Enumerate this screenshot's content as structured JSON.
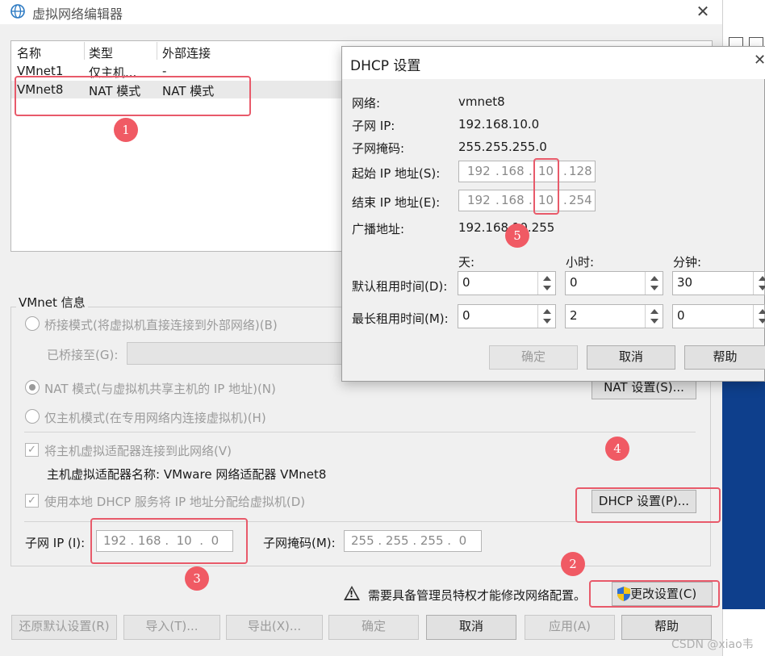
{
  "window": {
    "title": "虚拟网络编辑器",
    "close_glyph": "✕"
  },
  "network_list": {
    "columns": [
      "名称",
      "类型",
      "外部连接"
    ],
    "rows": [
      {
        "name": "VMnet1",
        "type": "仅主机...",
        "external": "-"
      },
      {
        "name": "VMnet8",
        "type": "NAT 模式",
        "external": "NAT 模式"
      }
    ]
  },
  "vmnet_info": {
    "group_label": "VMnet 信息",
    "bridge_mode": "桥接模式(将虚拟机直接连接到外部网络)(B)",
    "bridged_to_label": "已桥接至(G):",
    "nat_mode": "NAT 模式(与虚拟机共享主机的 IP 地址)(N)",
    "nat_settings_button": "NAT 设置(S)...",
    "host_only_mode": "仅主机模式(在专用网络内连接虚拟机)(H)",
    "connect_adapter": "将主机虚拟适配器连接到此网络(V)",
    "adapter_name": "主机虚拟适配器名称: VMware 网络适配器 VMnet8",
    "use_dhcp": "使用本地 DHCP 服务将 IP 地址分配给虚拟机(D)",
    "dhcp_settings_button": "DHCP 设置(P)...",
    "subnet_ip_label": "子网 IP (I):",
    "subnet_ip_value": "192 . 168 .  10  .  0",
    "subnet_mask_label": "子网掩码(M):",
    "subnet_mask_value": "255 . 255 . 255 .  0"
  },
  "admin_notice": "需要具备管理员特权才能修改网络配置。",
  "change_settings_button": "更改设置(C)",
  "bottom_buttons": {
    "restore": "还原默认设置(R)",
    "import": "导入(T)...",
    "export": "导出(X)...",
    "ok": "确定",
    "cancel": "取消",
    "apply": "应用(A)",
    "help": "帮助"
  },
  "dhcp_dialog": {
    "title": "DHCP 设置",
    "close_glyph": "✕",
    "network_label": "网络:",
    "network_value": "vmnet8",
    "subnet_ip_label": "子网 IP:",
    "subnet_ip_value": "192.168.10.0",
    "subnet_mask_label": "子网掩码:",
    "subnet_mask_value": "255.255.255.0",
    "start_ip_label": "起始 IP 地址(S):",
    "start_ip": {
      "a": "192",
      "b": "168",
      "c": "10",
      "d": "128"
    },
    "end_ip_label": "结束 IP 地址(E):",
    "end_ip": {
      "a": "192",
      "b": "168",
      "c": "10",
      "d": "254"
    },
    "broadcast_label": "广播地址:",
    "broadcast_value": "192.168.10.255",
    "days_label": "天:",
    "hours_label": "小时:",
    "minutes_label": "分钟:",
    "default_lease_label": "默认租用时间(D):",
    "default_lease": {
      "days": "0",
      "hours": "0",
      "minutes": "30"
    },
    "max_lease_label": "最长租用时间(M):",
    "max_lease": {
      "days": "0",
      "hours": "2",
      "minutes": "0"
    },
    "ok": "确定",
    "cancel": "取消",
    "help": "帮助"
  },
  "annotations": [
    "1",
    "2",
    "3",
    "4",
    "5"
  ],
  "watermark": "CSDN @xiao韦",
  "colors": {
    "annotation_red": "#e85a6a",
    "badge_red": "#f05a64",
    "side_blue": "#0e3f8c"
  }
}
